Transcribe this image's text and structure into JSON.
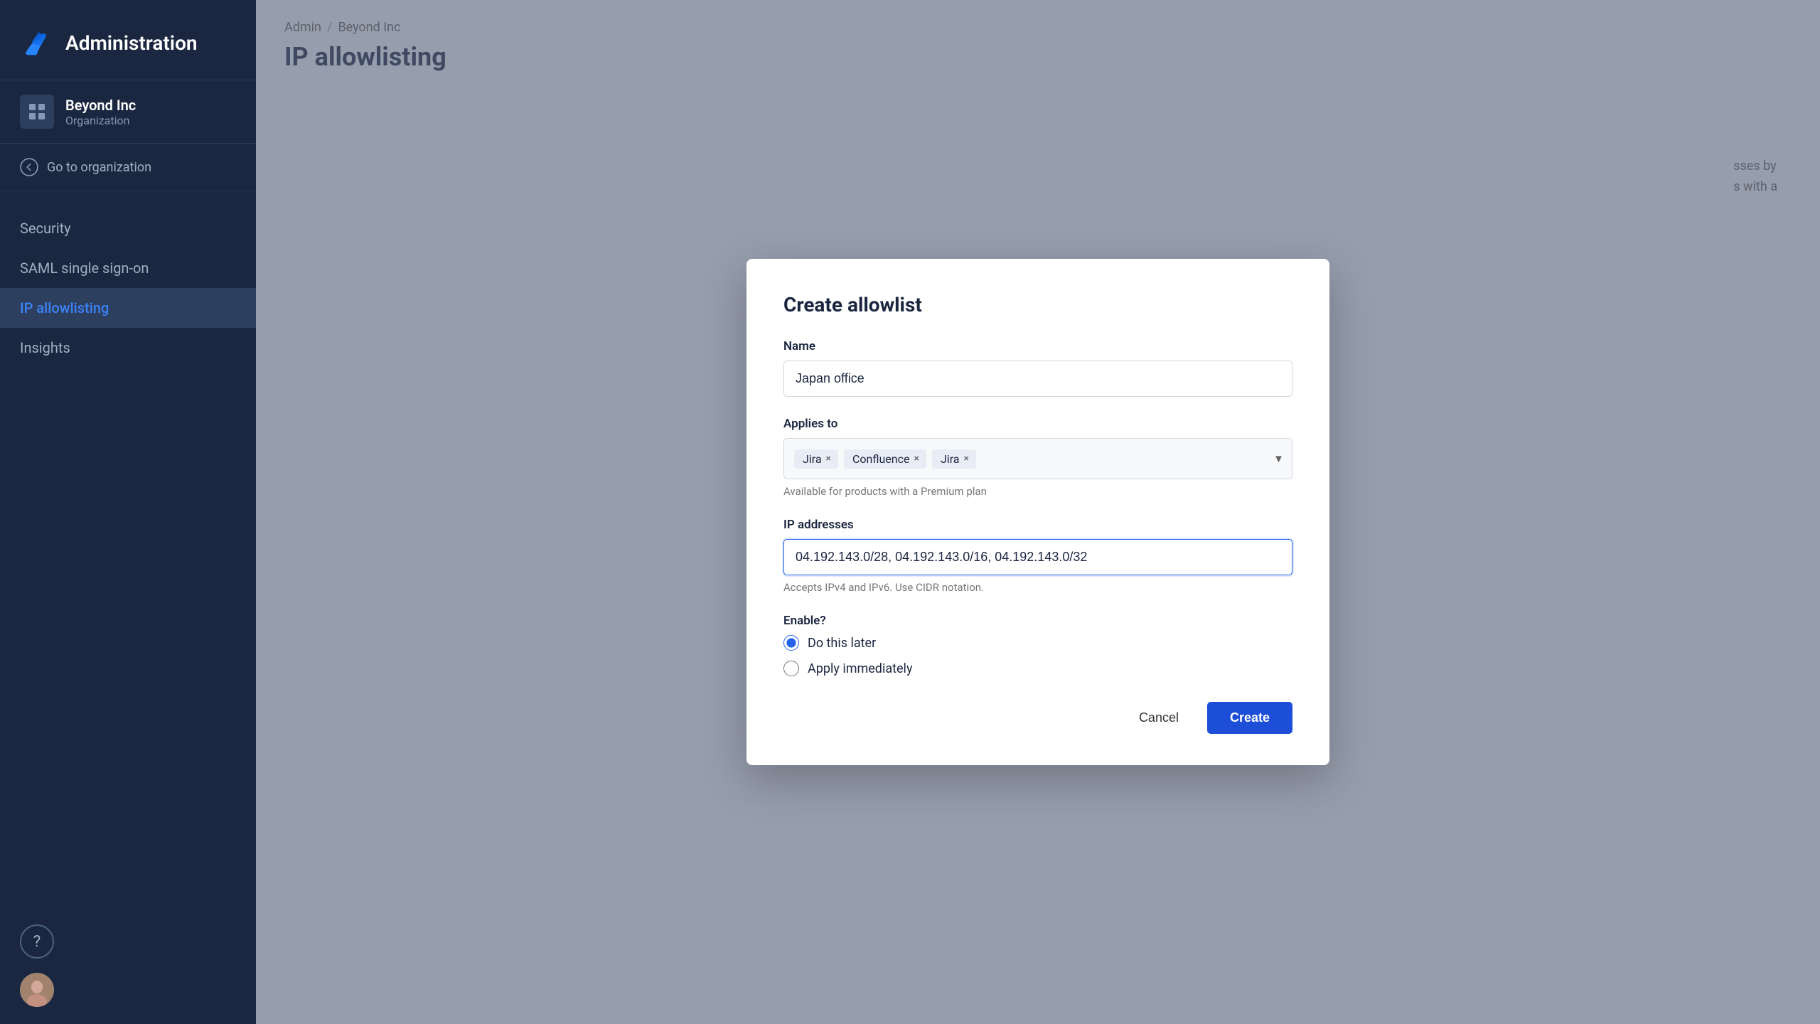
{
  "sidebar": {
    "app_title": "Administration",
    "org": {
      "name": "Beyond Inc",
      "type": "Organization"
    },
    "go_to_org_label": "Go to organization",
    "nav": [
      {
        "id": "security",
        "label": "Security",
        "active": false
      },
      {
        "id": "saml",
        "label": "SAML single sign-on",
        "active": false
      },
      {
        "id": "ip-allowlisting",
        "label": "IP allowlisting",
        "active": true
      },
      {
        "id": "insights",
        "label": "Insights",
        "active": false
      }
    ]
  },
  "breadcrumb": {
    "admin": "Admin",
    "separator": "/",
    "org": "Beyond Inc"
  },
  "page": {
    "title": "IP allowlisting"
  },
  "modal": {
    "title": "Create allowlist",
    "name_label": "Name",
    "name_value": "Japan office",
    "applies_to_label": "Applies to",
    "tags": [
      {
        "label": "Jira"
      },
      {
        "label": "Confluence"
      },
      {
        "label": "Jira"
      }
    ],
    "applies_note": "Available for products with a Premium plan",
    "ip_label": "IP addresses",
    "ip_value": "04.192.143.0/28, 04.192.143.0/16, 04.192.143.0/32",
    "ip_note": "Accepts IPv4 and IPv6. Use CIDR notation.",
    "enable_label": "Enable?",
    "radio_options": [
      {
        "id": "do-this-later",
        "label": "Do this later",
        "checked": true
      },
      {
        "id": "apply-immediately",
        "label": "Apply immediately",
        "checked": false
      }
    ],
    "cancel_label": "Cancel",
    "create_label": "Create"
  },
  "bg_text": {
    "line1": "sses by",
    "line2": "s with a"
  }
}
